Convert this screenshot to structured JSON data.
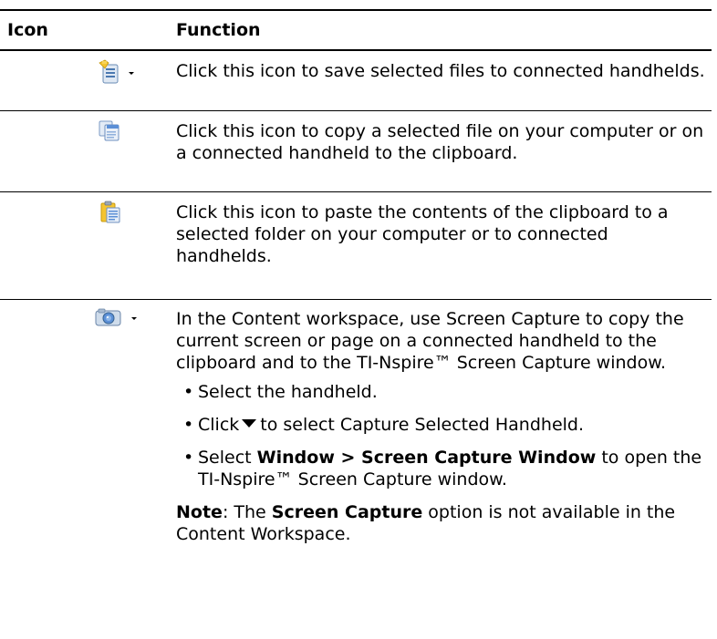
{
  "table": {
    "headers": {
      "icon": "Icon",
      "function": "Function"
    },
    "rows": [
      {
        "icon": "save-to-handheld-icon",
        "text": "Click this icon to save selected files to connected handhelds."
      },
      {
        "icon": "copy-icon",
        "text": "Click this icon to copy a selected file on your computer or on a connected handheld to the clipboard."
      },
      {
        "icon": "paste-icon",
        "text": "Click this icon to paste the contents of the clipboard to a selected folder on your computer or to connected handhelds."
      },
      {
        "icon": "screen-capture-icon",
        "text": "In the Content workspace, use Screen Capture to copy the current screen or page on a connected handheld to the clipboard and to the TI-Nspire™ Screen Capture window.",
        "bullets": {
          "b1": "Select the handheld.",
          "b2_pre": "Click",
          "b2_post": "to select Capture Selected Handheld.",
          "b3_pre": "Select",
          "b3_bold": "Window > Screen Capture Window",
          "b3_post": "to open the TI-Nspire™ Screen Capture window."
        },
        "note": {
          "label": "Note",
          "pre": ": The",
          "bold": "Screen Capture",
          "post": "option is not available in the Content Workspace."
        }
      }
    ]
  },
  "bullet_char": "•",
  "colors": {
    "icon_yellow": "#f4c430",
    "icon_blue": "#5b8fd6",
    "icon_page": "#e8eef7"
  }
}
